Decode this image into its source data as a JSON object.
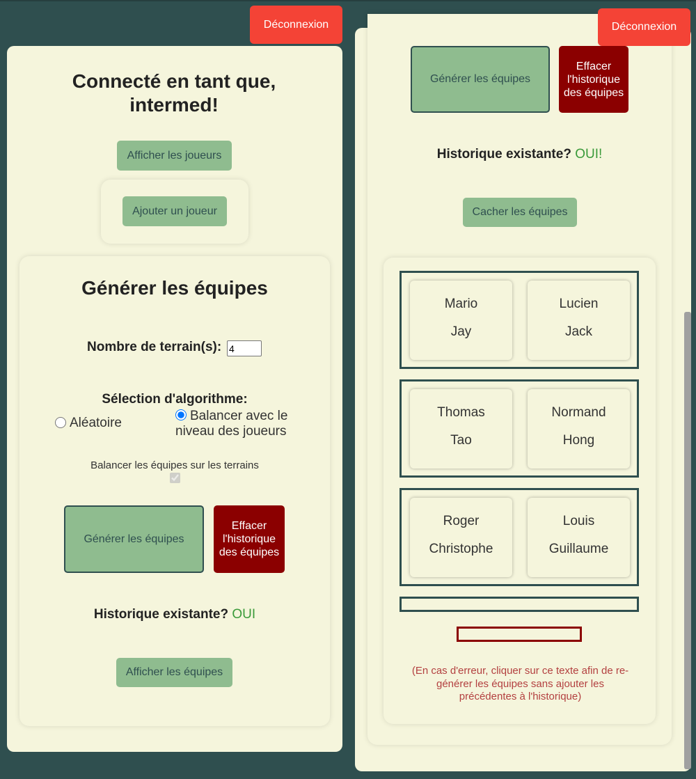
{
  "logout_label": "Déconnexion",
  "left": {
    "title": "Connecté en tant que, intermed!",
    "show_players": "Afficher les joueurs",
    "add_player": "Ajouter un joueur",
    "generate_heading": "Générer les équipes",
    "courts_label": "Nombre de terrain(s):",
    "courts_value": "4",
    "algo_label": "Sélection d'algorithme:",
    "algo_options": [
      {
        "label": "Aléatoire",
        "checked": false
      },
      {
        "label": "Balancer avec le niveau des joueurs",
        "checked": true
      }
    ],
    "balance_courts_label": "Balancer les équipes sur les terrains",
    "balance_courts_checked": true,
    "generate_button": "Générer les équipes",
    "clear_history_button": "Effacer l'historique des équipes",
    "history_label": "Historique existante?",
    "history_value": "OUI",
    "show_teams": "Afficher les équipes"
  },
  "right": {
    "generate_button": "Générer les équipes",
    "clear_history_button": "Effacer l'historique des équipes",
    "history_label": "Historique existante?",
    "history_value": "OUI!",
    "hide_teams": "Cacher les équipes",
    "courts": [
      {
        "teams": [
          [
            "Mario",
            "Jay"
          ],
          [
            "Lucien",
            "Jack"
          ]
        ]
      },
      {
        "teams": [
          [
            "Thomas",
            "Tao"
          ],
          [
            "Normand",
            "Hong"
          ]
        ]
      },
      {
        "teams": [
          [
            "Roger",
            "Christophe"
          ],
          [
            "Louis",
            "Guillaume"
          ]
        ]
      },
      {
        "teams": []
      }
    ],
    "error_note": "(En cas d'erreur, cliquer sur ce texte afin de re-générer les équipes sans ajouter les précédentes à l'historique)"
  },
  "colors": {
    "background": "#2f4f4f",
    "panel": "#f5f5dc",
    "green": "#8fbc8f",
    "dark_red": "#8b0000",
    "logout": "#f44336",
    "yes": "#3a9a3a"
  }
}
